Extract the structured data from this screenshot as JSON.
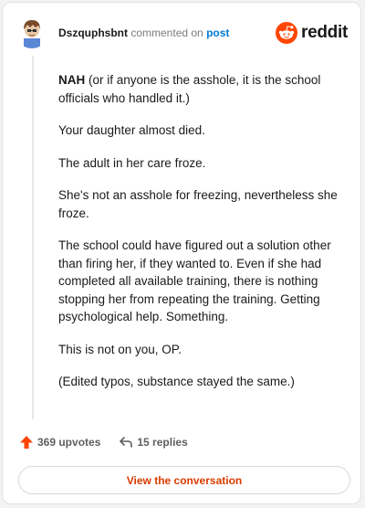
{
  "header": {
    "username": "Dszquphsbnt",
    "action_text": "commented on",
    "target_text": "post",
    "brand_name": "reddit",
    "brand_color": "#ff4500"
  },
  "comment": {
    "paragraphs": [
      {
        "bold": "NAH",
        "text": " (or if anyone is the asshole, it is the school officials who handled it.)"
      },
      {
        "bold": "",
        "text": "Your daughter almost died."
      },
      {
        "bold": "",
        "text": "The adult in her care froze."
      },
      {
        "bold": "",
        "text": "She's not an asshole for freezing, nevertheless she froze."
      },
      {
        "bold": "",
        "text": "The school could have figured out a solution other than firing her, if they wanted to. Even if she had completed all available training, there is nothing stopping her from repeating the training. Getting psychological help. Something."
      },
      {
        "bold": "",
        "text": "This is not on you, OP."
      },
      {
        "bold": "",
        "text": "(Edited typos, substance stayed the same.)"
      }
    ]
  },
  "footer": {
    "upvotes_label": "369 upvotes",
    "replies_label": "15 replies",
    "upvote_icon": "upvote-arrow-icon",
    "reply_icon": "reply-arrow-icon",
    "upvote_color": "#ff4500",
    "view_button_label": "View the conversation",
    "view_button_color": "#d93a00"
  }
}
